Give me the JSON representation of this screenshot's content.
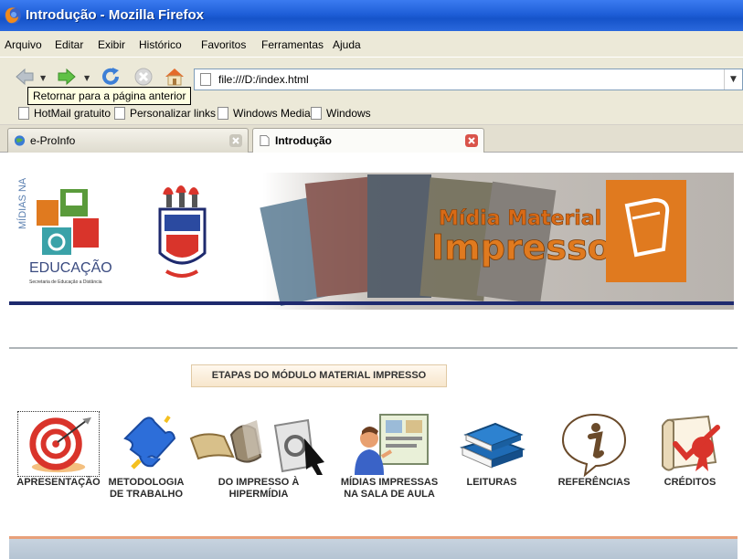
{
  "window": {
    "title": "Introdução - Mozilla Firefox"
  },
  "menu": [
    "Arquivo",
    "Editar",
    "Exibir",
    "Histórico",
    "Favoritos",
    "Ferramentas",
    "Ajuda"
  ],
  "navigation": {
    "url": "file:///D:/index.html",
    "tooltip": "Retornar para a página anterior"
  },
  "bookmarks": [
    "HotMail gratuito",
    "Personalizar links",
    "Windows Media",
    "Windows"
  ],
  "tabs": [
    {
      "label": "e-ProInfo",
      "active": false
    },
    {
      "label": "Introdução",
      "active": true
    }
  ],
  "banner": {
    "left_logo_lines": [
      "MÍDIAS NA",
      "EDUCAÇÃO",
      "Secretaria de Educação a Distância"
    ],
    "title_line1": "Mídia Material",
    "title_line2": "Impresso"
  },
  "section_title": "ETAPAS DO MÓDULO MATERIAL IMPRESSO",
  "modules": [
    {
      "label": [
        "APRESENTAÇÃO"
      ],
      "icon": "target-icon"
    },
    {
      "label": [
        "METODOLOGIA",
        "DE TRABALHO"
      ],
      "icon": "puzzle-icon"
    },
    {
      "label": [
        "DO IMPRESSO À",
        "HIPERMÍDIA"
      ],
      "icon": "scroll-to-web-icon"
    },
    {
      "label": [
        "MÍDIAS IMPRESSAS",
        "NA SALA DE AULA"
      ],
      "icon": "teacher-board-icon"
    },
    {
      "label": [
        "LEITURAS"
      ],
      "icon": "books-icon"
    },
    {
      "label": [
        "REFERÊNCIAS"
      ],
      "icon": "info-icon"
    },
    {
      "label": [
        "CRÉDITOS"
      ],
      "icon": "certificate-icon"
    }
  ],
  "colors": {
    "titlebar": "#1f5fd8",
    "chrome": "#ece9d8",
    "banner_accent": "#e07a1f",
    "banner_line": "#1e2a6e"
  }
}
